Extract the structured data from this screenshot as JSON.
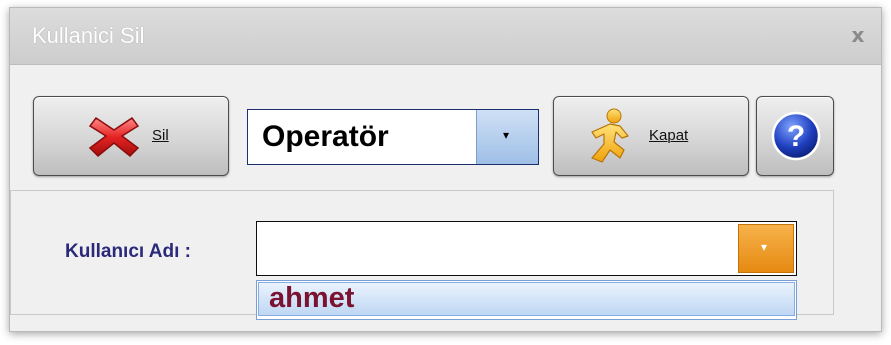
{
  "window": {
    "title": "Kullanici Sil",
    "close_glyph": "x"
  },
  "toolbar": {
    "delete_button": {
      "label": "Sil",
      "icon": "red-x-icon"
    },
    "role_select": {
      "value": "Operatör",
      "dropdown_glyph": "▾"
    },
    "close_button": {
      "label": "Kapat",
      "icon": "running-man-icon"
    },
    "help_button": {
      "icon": "help-icon",
      "glyph": "?"
    }
  },
  "form": {
    "username_label": "Kullanıcı Adı :",
    "username_value": "",
    "dropdown_glyph": "▾",
    "dropdown_items": [
      "ahmet"
    ]
  },
  "colors": {
    "delete_icon": "#e02020",
    "help_icon": "#1f3fbf",
    "label_text": "#2b2a7a",
    "item_text": "#7b1230",
    "user_dropdown_button": "#e68a12"
  }
}
